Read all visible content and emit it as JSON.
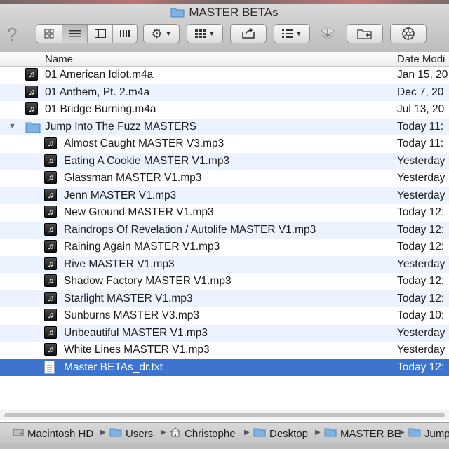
{
  "window": {
    "title": "MASTER BETAs"
  },
  "toolbar": {
    "help_icon": "question-icon",
    "view_modes": [
      "icon-view",
      "list-view",
      "column-view",
      "cover-flow-view"
    ],
    "active_view": "list-view",
    "action_icon": "gear-icon",
    "arrange_icon": "arrange-grid-icon",
    "share_icon": "share-icon",
    "sort_icon": "list-sort-icon",
    "new_folder_icon": "new-folder-icon",
    "burn_icon": "burn-icon"
  },
  "columns": {
    "name": "Name",
    "date": "Date Modi"
  },
  "files": [
    {
      "name": "01 American Idiot.m4a",
      "date": "Jan 15, 20",
      "kind": "music",
      "level": 0
    },
    {
      "name": "01 Anthem, Pt. 2.m4a",
      "date": "Dec 7, 20",
      "kind": "music",
      "level": 0
    },
    {
      "name": "01 Bridge Burning.m4a",
      "date": "Jul 13, 20",
      "kind": "music",
      "level": 0
    },
    {
      "name": "Jump Into The Fuzz MASTERS",
      "date": "Today 11:",
      "kind": "folder",
      "level": 0,
      "expanded": true
    },
    {
      "name": "Almost Caught MASTER V3.mp3",
      "date": "Today 11:",
      "kind": "music",
      "level": 1
    },
    {
      "name": "Eating A Cookie MASTER V1.mp3",
      "date": "Yesterday",
      "kind": "music",
      "level": 1
    },
    {
      "name": "Glassman MASTER V1.mp3",
      "date": "Yesterday",
      "kind": "music",
      "level": 1
    },
    {
      "name": "Jenn MASTER V1.mp3",
      "date": "Yesterday",
      "kind": "music",
      "level": 1
    },
    {
      "name": "New Ground MASTER V1.mp3",
      "date": "Today 12:",
      "kind": "music",
      "level": 1
    },
    {
      "name": "Raindrops Of Revelation / Autolife MASTER V1.mp3",
      "date": "Today 12:",
      "kind": "music",
      "level": 1
    },
    {
      "name": "Raining Again MASTER V1.mp3",
      "date": "Today 12:",
      "kind": "music",
      "level": 1
    },
    {
      "name": "Rive MASTER V1.mp3",
      "date": "Yesterday",
      "kind": "music",
      "level": 1
    },
    {
      "name": "Shadow Factory MASTER V1.mp3",
      "date": "Today 12:",
      "kind": "music",
      "level": 1
    },
    {
      "name": "Starlight MASTER V1.mp3",
      "date": "Today 12:",
      "kind": "music",
      "level": 1
    },
    {
      "name": "Sunburns MASTER V3.mp3",
      "date": "Today 10:",
      "kind": "music",
      "level": 1
    },
    {
      "name": "Unbeautiful MASTER V1.mp3",
      "date": "Yesterday",
      "kind": "music",
      "level": 1
    },
    {
      "name": "White Lines MASTER V1.mp3",
      "date": "Yesterday",
      "kind": "music",
      "level": 1
    },
    {
      "name": "Master BETAs_dr.txt",
      "date": "Today 12:",
      "kind": "text",
      "level": 1,
      "selected": true
    }
  ],
  "path": [
    {
      "label": "Macintosh HD",
      "icon": "hard-drive-icon"
    },
    {
      "label": "Users",
      "icon": "folder-icon"
    },
    {
      "label": "Christophe",
      "icon": "home-icon"
    },
    {
      "label": "Desktop",
      "icon": "folder-icon"
    },
    {
      "label": "MASTER BE",
      "icon": "folder-icon"
    },
    {
      "label": "Jump",
      "icon": "folder-icon"
    }
  ],
  "colors": {
    "selection": "#3c74cf",
    "stripe": "#edf3fe",
    "folder": "#7fb2e5"
  }
}
